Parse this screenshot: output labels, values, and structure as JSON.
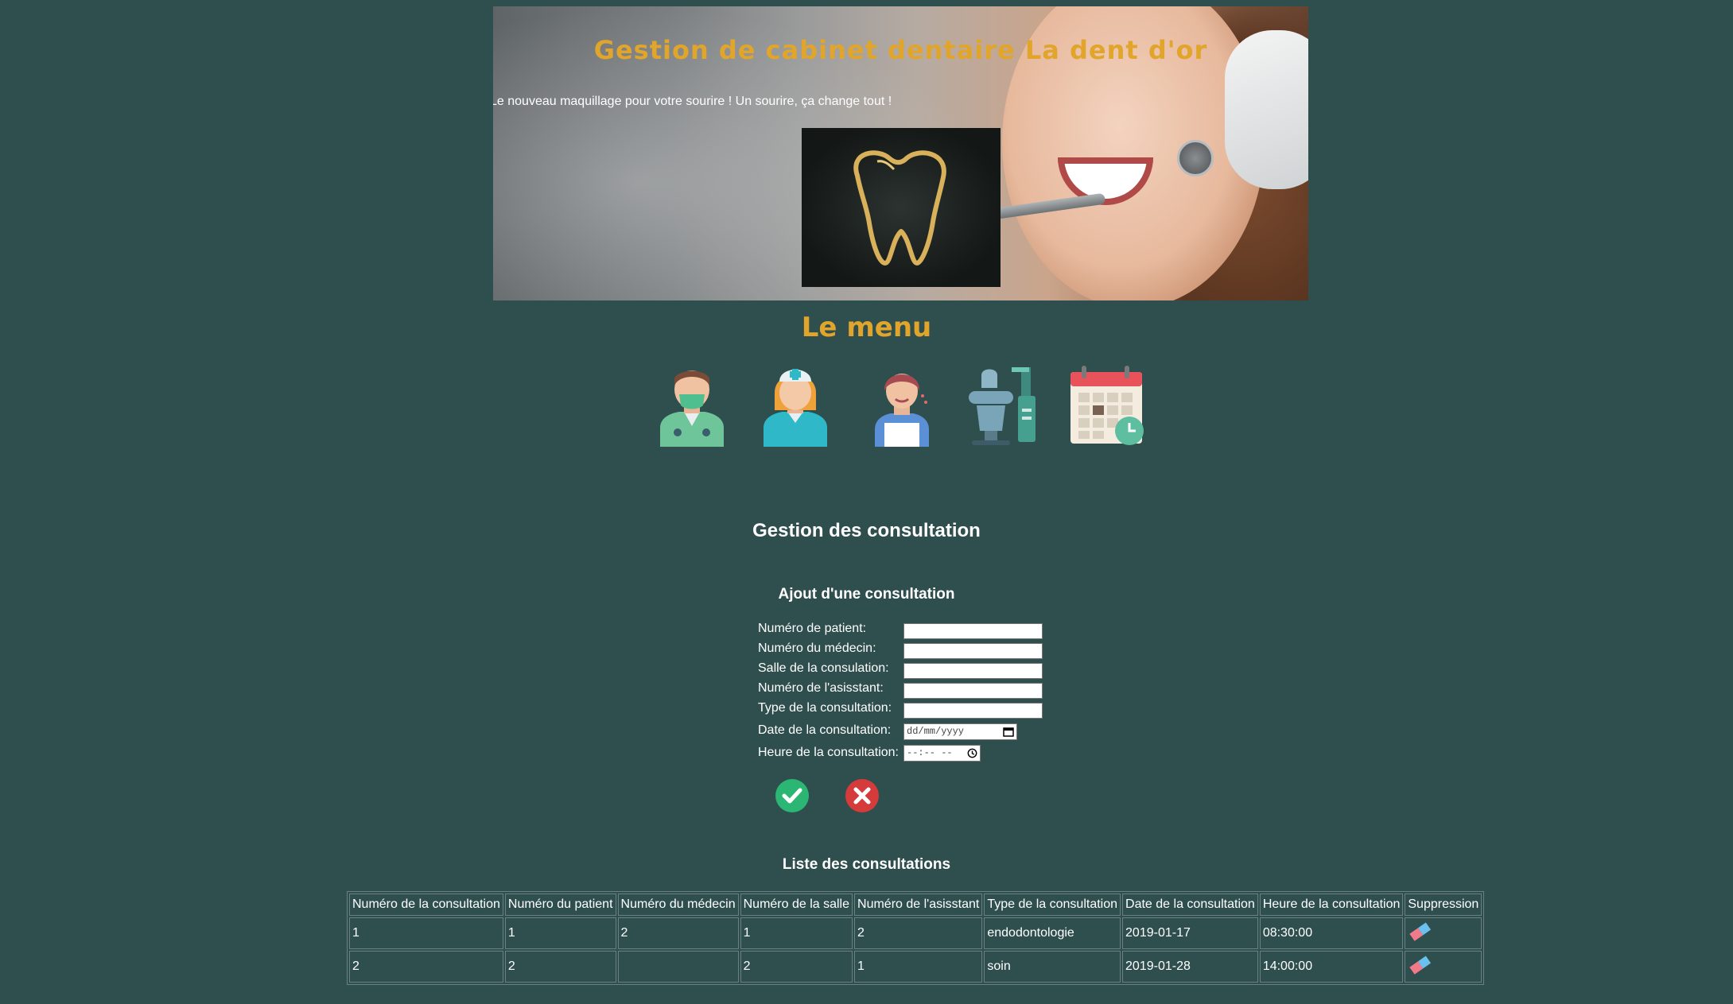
{
  "header": {
    "title": "Gestion de cabinet dentaire La dent d'or",
    "slogan": "Le nouveau maquillage pour votre sourire ! Un sourire, ça change tout !"
  },
  "menu": {
    "title": "Le menu",
    "items": [
      {
        "icon": "doctor-icon"
      },
      {
        "icon": "nurse-icon"
      },
      {
        "icon": "patient-icon"
      },
      {
        "icon": "dental-chair-icon"
      },
      {
        "icon": "calendar-icon"
      }
    ]
  },
  "page": {
    "title": "Gestion des consultation"
  },
  "form": {
    "title": "Ajout d'une consultation",
    "fields": [
      {
        "label": "Numéro de patient:",
        "value": ""
      },
      {
        "label": "Numéro du médecin:",
        "value": ""
      },
      {
        "label": "Salle de la consulation:",
        "value": ""
      },
      {
        "label": "Numéro de l'asisstant:",
        "value": ""
      },
      {
        "label": "Type de la consultation:",
        "value": ""
      },
      {
        "label": "Date de la consultation:",
        "placeholder": "dd/mm/yyyy"
      },
      {
        "label": "Heure de la consultation:",
        "placeholder": "--:-- --"
      }
    ],
    "submit_icon": "check-icon",
    "cancel_icon": "cross-icon"
  },
  "list": {
    "title": "Liste des consultations",
    "columns": [
      "Numéro de la consultation",
      "Numéro du patient",
      "Numéro du médecin",
      "Numéro de la salle",
      "Numéro de l'asisstant",
      "Type de la consultation",
      "Date de la consultation",
      "Heure de la consultation",
      "Suppression"
    ],
    "rows": [
      [
        "1",
        "1",
        "2",
        "1",
        "2",
        "endodontologie",
        "2019-01-17",
        "08:30:00"
      ],
      [
        "2",
        "2",
        "",
        "2",
        "1",
        "soin",
        "2019-01-28",
        "14:00:00"
      ]
    ],
    "delete_icon": "eraser-icon"
  },
  "colors": {
    "background": "#2f4f4f",
    "accent": "#e0a52a",
    "confirm": "#2bb673",
    "cancel": "#d63b3b"
  }
}
